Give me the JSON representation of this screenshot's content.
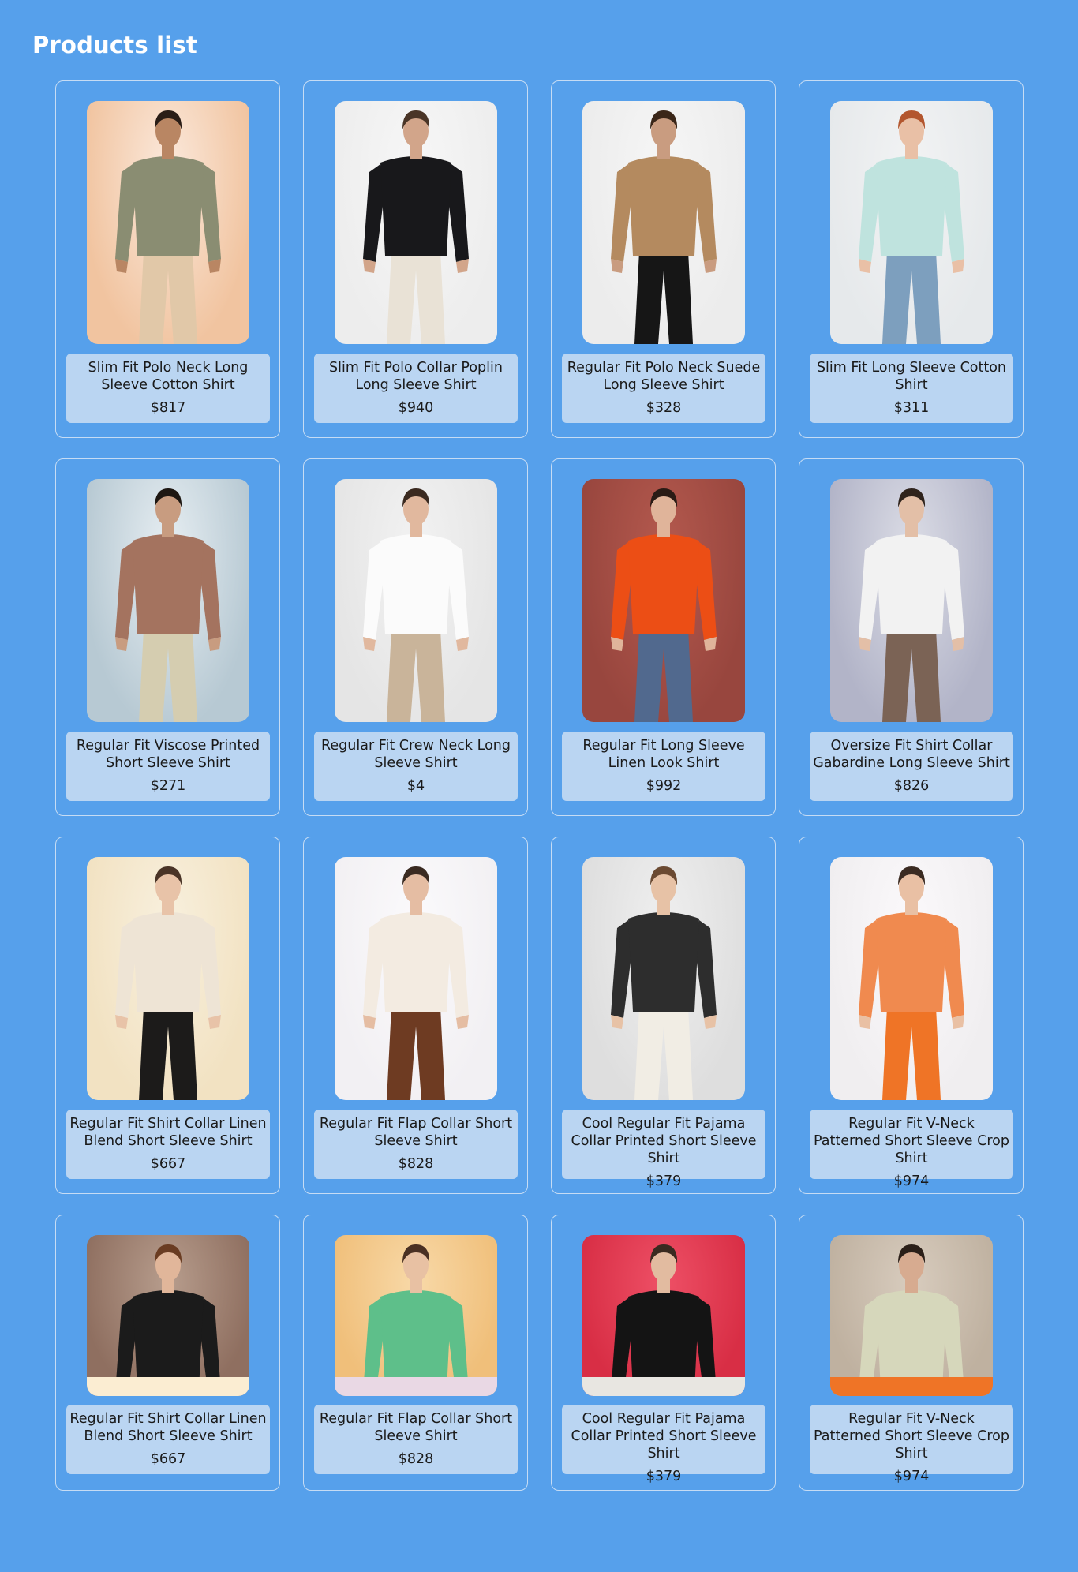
{
  "page": {
    "title": "Products list"
  },
  "products": [
    {
      "name": "Slim Fit Polo Neck Long Sleeve Cotton Shirt",
      "price": "$817",
      "photo": {
        "bg": "#f1c4a0",
        "bg2": "#fbe9dc",
        "skin": "#b98663",
        "hair": "#2a1d16",
        "top": "#8a8d72",
        "bottom": "#e1c8a8"
      }
    },
    {
      "name": "Slim Fit Polo Collar Poplin Long Sleeve Shirt",
      "price": "$940",
      "photo": {
        "bg": "#ededed",
        "bg2": "#f7f7f7",
        "skin": "#d2a58a",
        "hair": "#4a3527",
        "top": "#18181b",
        "bottom": "#e9e2d6"
      }
    },
    {
      "name": "Regular Fit Polo Neck Suede Long Sleeve Shirt",
      "price": "$328",
      "photo": {
        "bg": "#ececec",
        "bg2": "#f6f6f6",
        "skin": "#c99c80",
        "hair": "#3a2618",
        "top": "#b48a5f",
        "bottom": "#161616"
      }
    },
    {
      "name": "Slim Fit Long Sleeve Cotton Shirt",
      "price": "$311",
      "photo": {
        "bg": "#e6e9eb",
        "bg2": "#f2f3f4",
        "skin": "#e9c0a6",
        "hair": "#b3562e",
        "top": "#bfe3de",
        "bottom": "#7d9fbe"
      }
    },
    {
      "name": "Regular Fit Viscose Printed Short Sleeve Shirt",
      "price": "$271",
      "photo": {
        "bg": "#b7c9d3",
        "bg2": "#e7eef2",
        "skin": "#c89c80",
        "hair": "#1e1712",
        "top": "#a4735f",
        "bottom": "#d5cdb0"
      }
    },
    {
      "name": "Regular Fit Crew Neck Long Sleeve Shirt",
      "price": "$4",
      "photo": {
        "bg": "#e5e5e5",
        "bg2": "#f2f2f2",
        "skin": "#e1b89e",
        "hair": "#3b2a20",
        "top": "#fbfbfb",
        "bottom": "#c9b49a"
      }
    },
    {
      "name": "Regular Fit Long Sleeve Linen Look Shirt",
      "price": "$992",
      "photo": {
        "bg": "#98463e",
        "bg2": "#b4594e",
        "skin": "#e0b49a",
        "hair": "#2a1b15",
        "top": "#ec4e15",
        "bottom": "#51698e"
      }
    },
    {
      "name": "Oversize Fit Shirt Collar Gabardine Long Sleeve Shirt",
      "price": "$826",
      "photo": {
        "bg": "#b2b4c8",
        "bg2": "#dcdde6",
        "skin": "#e3bfa7",
        "hair": "#2f231c",
        "top": "#f2f2f2",
        "bottom": "#7b6355"
      }
    },
    {
      "name": "Regular Fit Shirt Collar Linen Blend Short Sleeve Shirt",
      "price": "$667",
      "photo": {
        "bg": "#f2e2c2",
        "bg2": "#f8f0de",
        "skin": "#e8c3a8",
        "hair": "#4a3427",
        "top": "#eee4d5",
        "bottom": "#1c1b1a"
      }
    },
    {
      "name": "Regular Fit Flap Collar Short Sleeve Shirt",
      "price": "$828",
      "photo": {
        "bg": "#f2f0f3",
        "bg2": "#fbfafc",
        "skin": "#e5bda3",
        "hair": "#3a2a21",
        "top": "#f3ebe1",
        "bottom": "#6e3b22"
      }
    },
    {
      "name": "Cool Regular Fit Pajama Collar Printed Short Sleeve Shirt",
      "price": "$379",
      "photo": {
        "bg": "#dedede",
        "bg2": "#efefef",
        "skin": "#e7c2a6",
        "hair": "#6b4a32",
        "top": "#2d2d2d",
        "bottom": "#f1ede4"
      }
    },
    {
      "name": "Regular Fit V-Neck Patterned Short Sleeve Crop Shirt",
      "price": "$974",
      "photo": {
        "bg": "#f0eef0",
        "bg2": "#fbf9fb",
        "skin": "#e9c0a4",
        "hair": "#3b2b22",
        "top": "#f08a4f",
        "bottom": "#ef7426"
      }
    },
    {
      "name": "Regular Fit Shirt Collar Linen Blend Short Sleeve Shirt",
      "price": "$667",
      "photo": {
        "bg": "#8f6f60",
        "bg2": "#b79d8d",
        "skin": "#e1b69a",
        "hair": "#6a3c22",
        "top": "#1b1b1b",
        "bottom": "#c48d4a",
        "stripe": "#fbedd2"
      }
    },
    {
      "name": "Regular Fit Flap Collar Short Sleeve Shirt",
      "price": "$828",
      "photo": {
        "bg": "#f0bf7a",
        "bg2": "#f8d9a8",
        "skin": "#e8c1a3",
        "hair": "#4a3023",
        "top": "#5ebf8a",
        "bottom": "#e7e4ea",
        "stripe": "#e9d8e4"
      }
    },
    {
      "name": "Cool Regular Fit Pajama Collar Printed Short Sleeve Shirt",
      "price": "$379",
      "photo": {
        "bg": "#d82e45",
        "bg2": "#ee5066",
        "skin": "#e2bba0",
        "hair": "#3a2a20",
        "top": "#141414",
        "bottom": "#141414",
        "stripe": "#e8e6e1"
      }
    },
    {
      "name": "Regular Fit V-Neck Patterned Short Sleeve Crop Shirt",
      "price": "$974",
      "photo": {
        "bg": "#bfb1a0",
        "bg2": "#d8ccbe",
        "skin": "#d7ab90",
        "hair": "#2b1f18",
        "top": "#d6d7bb",
        "bottom": "#d8d6bd",
        "stripe": "#ef7426"
      }
    }
  ]
}
